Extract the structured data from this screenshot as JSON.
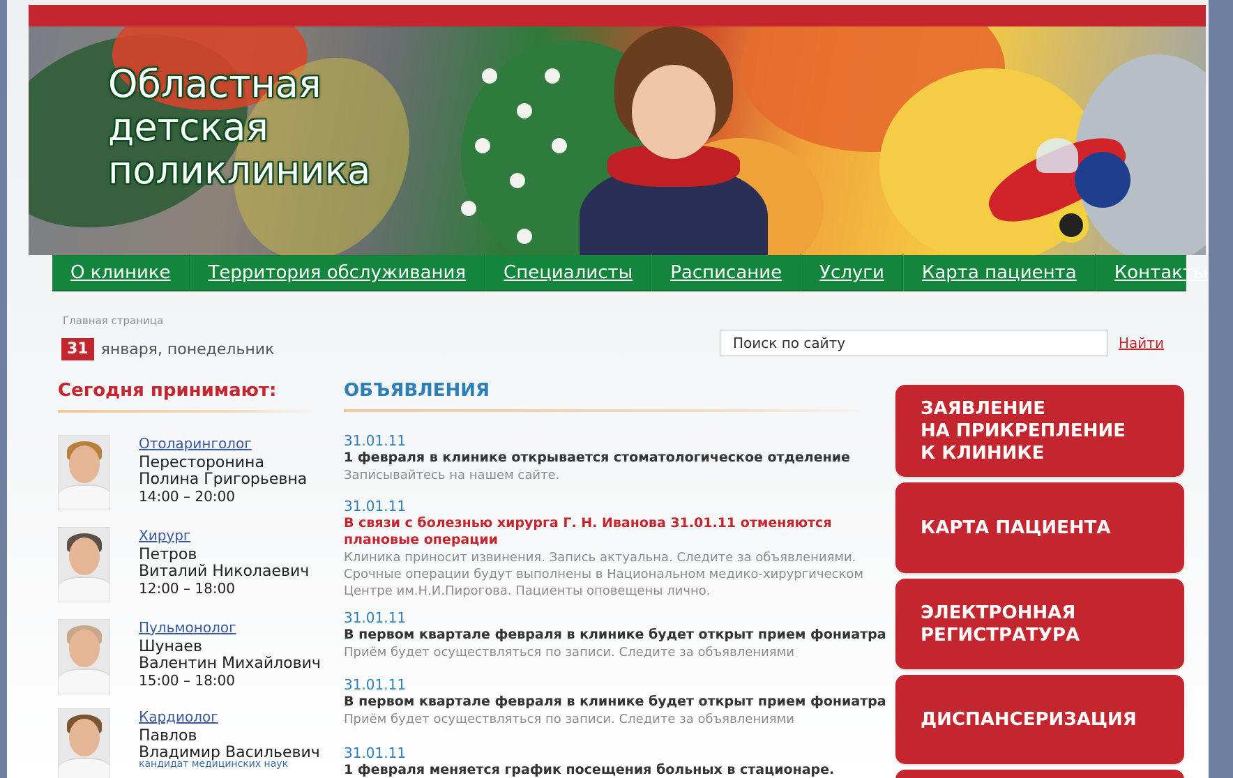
{
  "site": {
    "title_lines": [
      "Областная",
      "детская",
      "поликлиника"
    ]
  },
  "nav": {
    "items": [
      {
        "label": "О клинике"
      },
      {
        "label": "Территория обслуживания"
      },
      {
        "label": "Специалисты"
      },
      {
        "label": "Расписание"
      },
      {
        "label": "Услуги"
      },
      {
        "label": "Карта пациента"
      },
      {
        "label": "Контакты"
      }
    ]
  },
  "breadcrumb": "Главная страница",
  "date": {
    "day": "31",
    "rest": "января, понедельник"
  },
  "search": {
    "placeholder": "Поиск по сайту",
    "button": "Найти"
  },
  "today": {
    "heading": "Сегодня принимают:",
    "doctors": [
      {
        "specialty": "Отоларинголог",
        "name_lines": [
          "Пересторонина",
          "Полина Григорьевна"
        ],
        "hours": "14:00 – 20:00",
        "degree": ""
      },
      {
        "specialty": "Хирург",
        "name_lines": [
          "Петров",
          "Виталий Николаевич"
        ],
        "hours": "12:00 – 18:00",
        "degree": ""
      },
      {
        "specialty": "Пульмонолог",
        "name_lines": [
          "Шунаев",
          "Валентин Михайлович"
        ],
        "hours": "15:00 – 18:00",
        "degree": ""
      },
      {
        "specialty": "Кардиолог",
        "name_lines": [
          "Павлов",
          "Владимир Васильевич"
        ],
        "hours": "",
        "degree": "кандидат медицинских наук"
      }
    ]
  },
  "announcements": {
    "heading": "ОБЪЯВЛЕНИЯ",
    "items": [
      {
        "date": "31.01.11",
        "title": "1 февраля в клинике открывается стоматологическое отделение",
        "text": "Записывайтесь на нашем сайте."
      },
      {
        "date": "31.01.11",
        "title": "В связи с болезнью хирурга Г. Н. Иванова 31.01.11 отменяются плановые операции",
        "text": "Клиника приносит извинения. Запись актуальна. Следите за объявлениями. Срочные операции будут выполнены в Национальном медико-хирургическом Центре им.Н.И.Пирогова. Пациенты оповещены лично."
      },
      {
        "date": "31.01.11",
        "title": "В первом квартале февраля в клинике будет открыт прием фониатра",
        "text": "Приём будет осуществляться по записи. Следите за объявлениями"
      },
      {
        "date": "31.01.11",
        "title": "В первом квартале февраля в клинике будет открыт прием фониатра",
        "text": "Приём будет осуществляться по записи. Следите за объявлениями"
      },
      {
        "date": "31.01.11",
        "title": "1 февраля меняется график посещения больных в стационаре.",
        "text": ""
      }
    ]
  },
  "side_buttons": [
    {
      "lines": [
        "ЗАЯВЛЕНИЕ",
        "НА ПРИКРЕПЛЕНИЕ",
        "К КЛИНИКЕ"
      ]
    },
    {
      "lines": [
        "КАРТА ПАЦИЕНТА"
      ]
    },
    {
      "lines": [
        "ЭЛЕКТРОННАЯ",
        "РЕГИСТРАТУРА"
      ]
    },
    {
      "lines": [
        "ДИСПАНСЕРИЗАЦИЯ"
      ]
    }
  ],
  "colors": {
    "brand_red": "#c3262e",
    "nav_green": "#13853c",
    "link_blue": "#2d7fb8"
  }
}
